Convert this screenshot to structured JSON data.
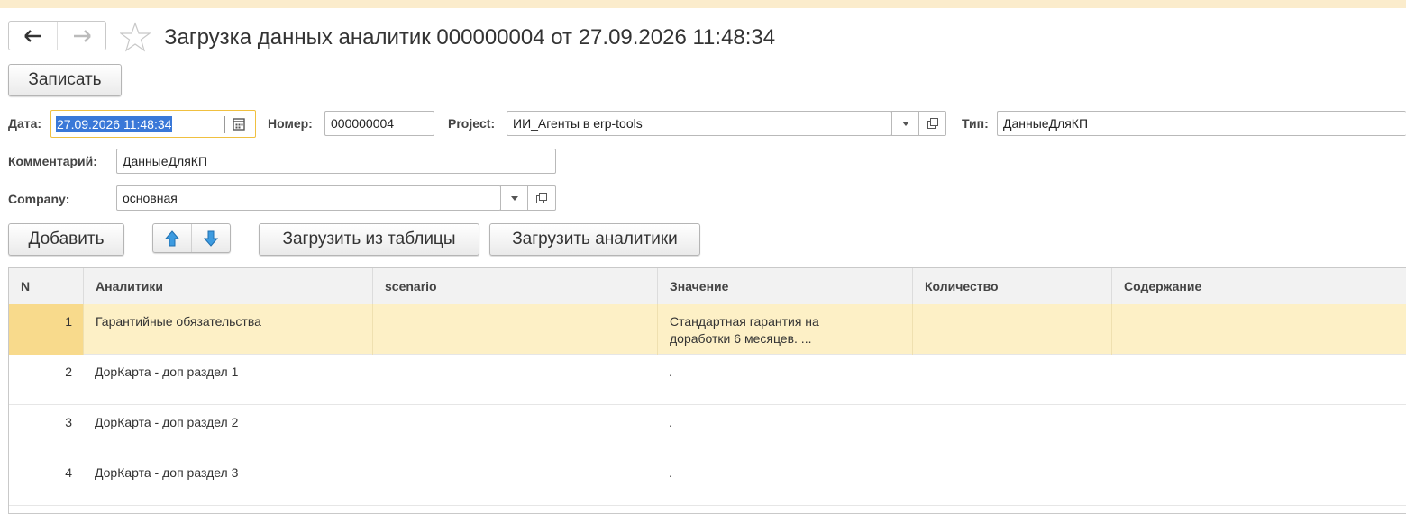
{
  "window": {
    "title": "Загрузка данных аналитик 000000004 от 27.09.2026 11:48:34"
  },
  "toolbar": {
    "save_label": "Записать"
  },
  "form": {
    "date_label": "Дата:",
    "date_value": "27.09.2026 11:48:34",
    "number_label": "Номер:",
    "number_value": "000000004",
    "project_label": "Project:",
    "project_value": "ИИ_Агенты в erp-tools",
    "type_label": "Тип:",
    "type_value": "ДанныеДляКП",
    "comment_label": "Комментарий:",
    "comment_value": "ДанныеДляКП",
    "company_label": "Company:",
    "company_value": "основная"
  },
  "table_toolbar": {
    "add_label": "Добавить",
    "load_from_table_label": "Загрузить из таблицы",
    "load_analytics_label": "Загрузить аналитики"
  },
  "table": {
    "columns": [
      "N",
      "Аналитики",
      "scenario",
      "Значение",
      "Количество",
      "Содержание"
    ],
    "rows": [
      {
        "n": "1",
        "analytics": "Гарантийные обязательства",
        "scenario": "",
        "value": "Стандартная гарантия на доработки 6 месяцев. ...",
        "quantity": "",
        "content": ""
      },
      {
        "n": "2",
        "analytics": "ДорКарта - доп раздел 1",
        "scenario": "",
        "value": ".",
        "quantity": "",
        "content": ""
      },
      {
        "n": "3",
        "analytics": "ДорКарта - доп раздел 2",
        "scenario": "",
        "value": ".",
        "quantity": "",
        "content": ""
      },
      {
        "n": "4",
        "analytics": "ДорКарта - доп раздел 3",
        "scenario": "",
        "value": ".",
        "quantity": "",
        "content": ""
      }
    ]
  },
  "icons": {
    "back": "arrow-left-icon",
    "forward": "arrow-right-icon",
    "favorite": "star-icon",
    "calendar": "calendar-icon",
    "dropdown": "chevron-down-icon",
    "open": "open-form-icon",
    "move_up": "arrow-up-icon",
    "move_down": "arrow-down-icon"
  },
  "colors": {
    "selection": "#3a78d8",
    "focus_border": "#f0c040",
    "selected_row": "#fdf0c6",
    "move_arrows": "#3d9be0"
  }
}
